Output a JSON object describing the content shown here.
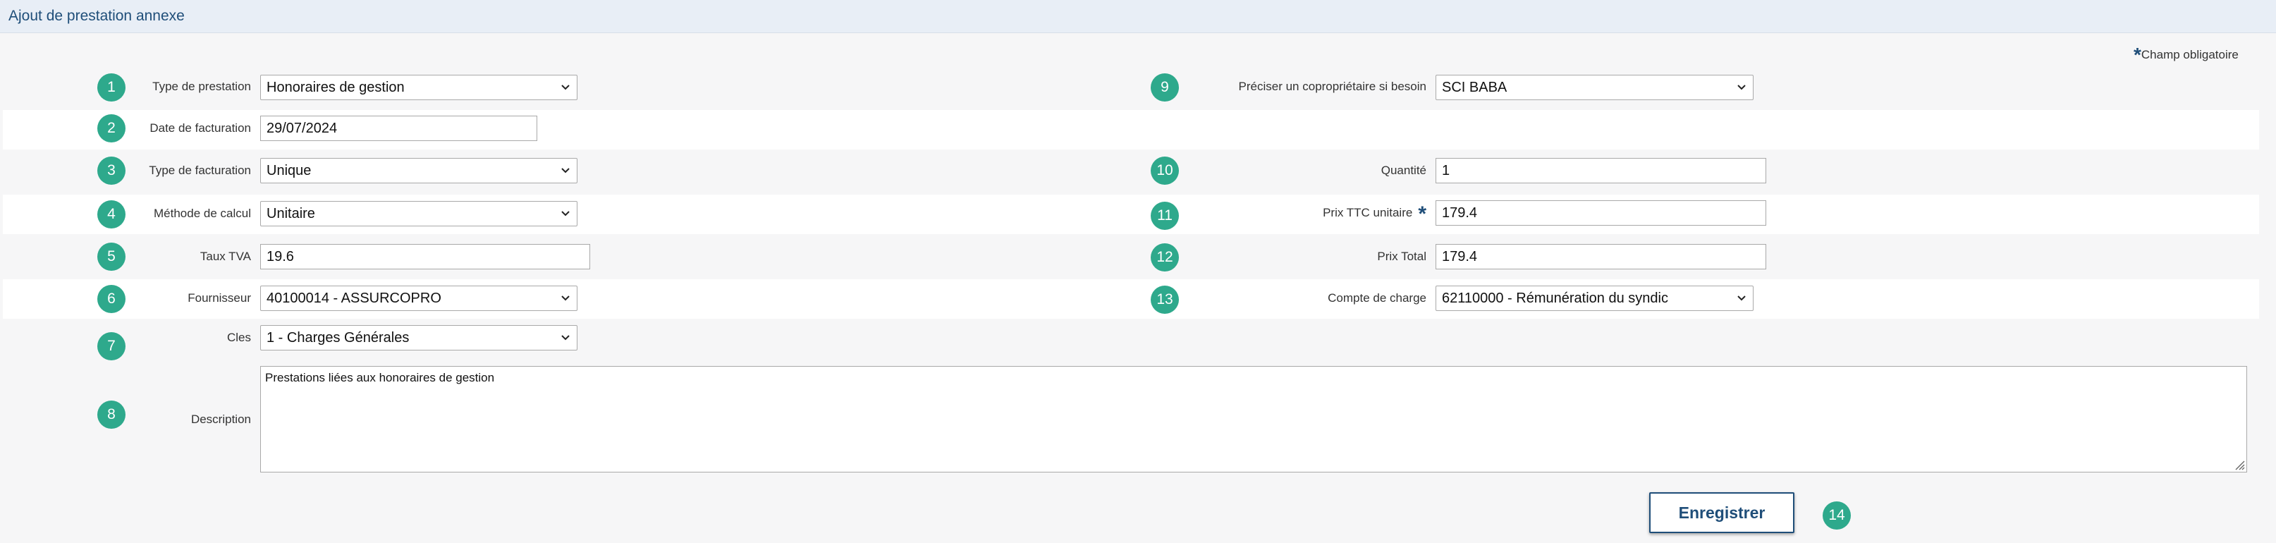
{
  "header": {
    "title": "Ajout de prestation annexe"
  },
  "required_note": {
    "star": "*",
    "text": "Champ obligatoire"
  },
  "badges": {
    "b1": "1",
    "b2": "2",
    "b3": "3",
    "b4": "4",
    "b5": "5",
    "b6": "6",
    "b7": "7",
    "b8": "8",
    "b9": "9",
    "b10": "10",
    "b11": "11",
    "b12": "12",
    "b13": "13",
    "b14": "14"
  },
  "left": {
    "type_prestation": {
      "label": "Type de prestation",
      "value": "Honoraires de gestion"
    },
    "date_facturation": {
      "label": "Date de facturation",
      "value": "29/07/2024"
    },
    "type_facturation": {
      "label": "Type de facturation",
      "value": "Unique"
    },
    "methode_calcul": {
      "label": "Méthode de calcul",
      "value": "Unitaire"
    },
    "taux_tva": {
      "label": "Taux TVA",
      "value": "19.6"
    },
    "fournisseur": {
      "label": "Fournisseur",
      "value": "40100014 - ASSURCOPRO"
    },
    "cles": {
      "label": "Cles",
      "value": "1 - Charges Générales"
    },
    "description": {
      "label": "Description",
      "value": "Prestations liées aux honoraires de gestion"
    }
  },
  "right": {
    "coproprietaire": {
      "label": "Préciser un copropriétaire si besoin",
      "value": "SCI BABA"
    },
    "quantite": {
      "label": "Quantité",
      "value": "1"
    },
    "prix_ttc_unitaire": {
      "label": "Prix TTC unitaire",
      "required": "*",
      "value": "179.4"
    },
    "prix_total": {
      "label": "Prix Total",
      "value": "179.4"
    },
    "compte_charge": {
      "label": "Compte de charge",
      "value": "62110000 - Rémunération du syndic"
    }
  },
  "actions": {
    "save_label": "Enregistrer"
  },
  "colors": {
    "accent": "#1f4e79",
    "badge": "#2ea98c",
    "header_bg": "#e8eef6"
  }
}
